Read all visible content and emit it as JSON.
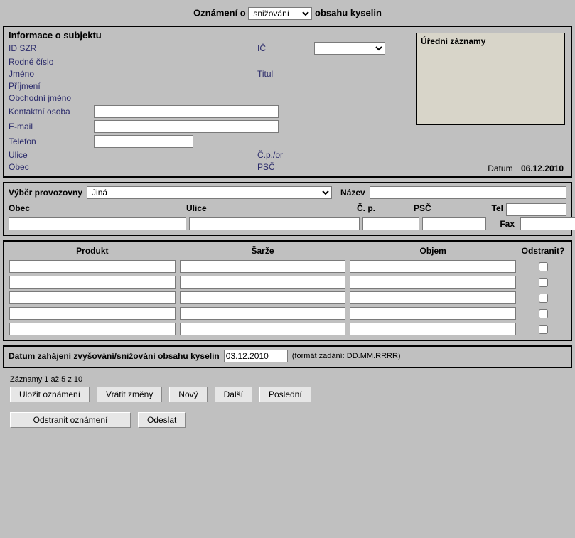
{
  "title": {
    "pre": "Oznámení o",
    "post": "obsahu kyselin",
    "select_value": "snižování"
  },
  "subject": {
    "heading": "Informace o subjektu",
    "labels": {
      "id_szr": "ID SZR",
      "ic": "IČ",
      "rodne_cislo": "Rodné číslo",
      "jmeno": "Jméno",
      "titul": "Titul",
      "prijmeni": "Příjmení",
      "obchodni_jmeno": "Obchodní jméno",
      "kontaktni_osoba": "Kontaktní osoba",
      "email": "E-mail",
      "telefon": "Telefon",
      "ulice": "Ulice",
      "cp_or": "Č.p./or",
      "obec": "Obec",
      "psc": "PSČ",
      "datum": "Datum"
    },
    "values": {
      "id_szr": "",
      "ic": "",
      "rodne_cislo": "",
      "jmeno": "",
      "titul": "",
      "prijmeni": "",
      "obchodni_jmeno": "",
      "kontaktni_osoba": "",
      "email": "",
      "telefon": "",
      "ulice": "",
      "cp_or": "",
      "obec": "",
      "psc": "",
      "datum": "06.12.2010"
    },
    "official_heading": "Úřední záznamy"
  },
  "provozovna": {
    "labels": {
      "vyber": "Výběr provozovny",
      "nazev": "Název",
      "obec": "Obec",
      "ulice": "Ulice",
      "cp": "Č. p.",
      "psc": "PSČ",
      "tel": "Tel",
      "fax": "Fax"
    },
    "select_value": "Jiná",
    "values": {
      "nazev": "",
      "obec": "",
      "ulice": "",
      "cp": "",
      "psc": "",
      "tel": "",
      "fax": ""
    }
  },
  "items": {
    "headers": {
      "produkt": "Produkt",
      "sarze": "Šarže",
      "objem": "Objem",
      "odstranit": "Odstranit?"
    },
    "rows": [
      {
        "produkt": "",
        "sarze": "",
        "objem": "",
        "odstranit": false
      },
      {
        "produkt": "",
        "sarze": "",
        "objem": "",
        "odstranit": false
      },
      {
        "produkt": "",
        "sarze": "",
        "objem": "",
        "odstranit": false
      },
      {
        "produkt": "",
        "sarze": "",
        "objem": "",
        "odstranit": false
      },
      {
        "produkt": "",
        "sarze": "",
        "objem": "",
        "odstranit": false
      }
    ]
  },
  "start": {
    "label": "Datum zahájení zvyšování/snižování obsahu kyselin",
    "value": "03.12.2010",
    "hint": "(formát zadání: DD.MM.RRRR)"
  },
  "footer": {
    "rec_count": "Záznamy 1 až 5 z 10",
    "buttons": {
      "ulozit": "Uložit oznámení",
      "vratit": "Vrátit změny",
      "novy": "Nový",
      "dalsi": "Další",
      "posledni": "Poslední",
      "odstranit": "Odstranit oznámení",
      "odeslat": "Odeslat"
    }
  }
}
